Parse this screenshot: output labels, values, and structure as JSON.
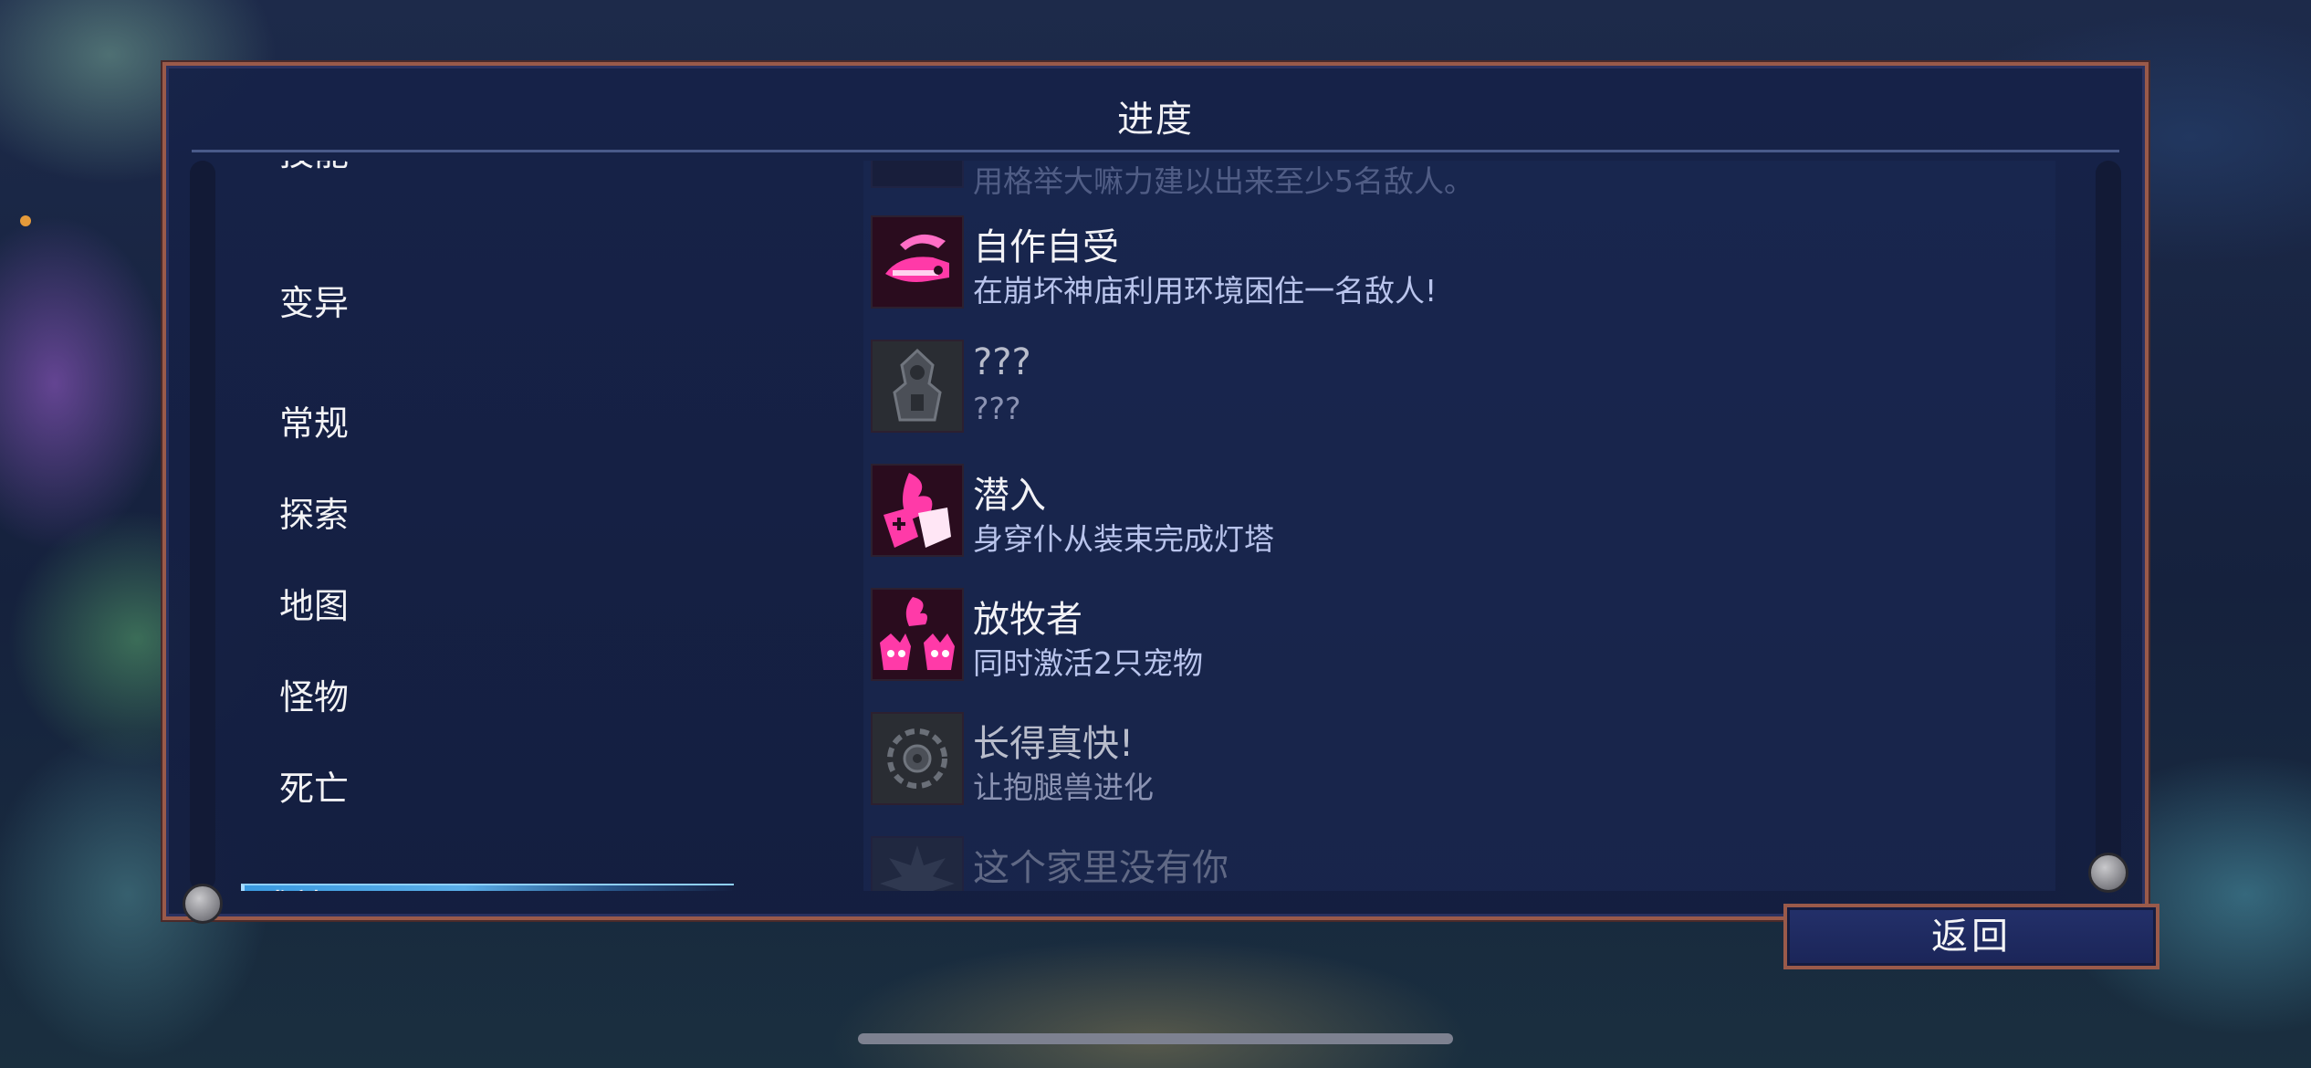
{
  "window": {
    "title": "进度"
  },
  "categories": [
    {
      "label": "技能"
    },
    {
      "label": "变异"
    },
    {
      "label": "常规"
    },
    {
      "label": "探索"
    },
    {
      "label": "地图"
    },
    {
      "label": "怪物"
    },
    {
      "label": "死亡"
    },
    {
      "label": "成就",
      "selected": true
    }
  ],
  "achievements": [
    {
      "name": "",
      "desc": "用格举大嘛力建以出来至少5名敌人。",
      "state": "partial-top",
      "icon": "achievement-icon"
    },
    {
      "name": "自作自受",
      "desc": "在崩坏神庙利用环境困住一名敌人!",
      "state": "unlocked",
      "icon": "serpent-blade-icon"
    },
    {
      "name": "???",
      "desc": "???",
      "state": "locked",
      "icon": "hidden-achievement-icon"
    },
    {
      "name": "潜入",
      "desc": "身穿仆从装束完成灯塔",
      "state": "unlocked",
      "icon": "flame-shield-icon"
    },
    {
      "name": "放牧者",
      "desc": "同时激活2只宠物",
      "state": "unlocked",
      "icon": "pets-icon"
    },
    {
      "name": "长得真快!",
      "desc": "让抱腿兽进化",
      "state": "locked",
      "icon": "eye-gear-icon"
    },
    {
      "name": "这个家里没有你",
      "desc": "",
      "state": "partial-bottom",
      "icon": "spiky-icon"
    }
  ],
  "buttons": {
    "back": "返回"
  },
  "colors": {
    "accent_selected": "#4aa3e6",
    "frame": "#9a5a4a",
    "unlocked_icon": "#ff3aa8"
  }
}
